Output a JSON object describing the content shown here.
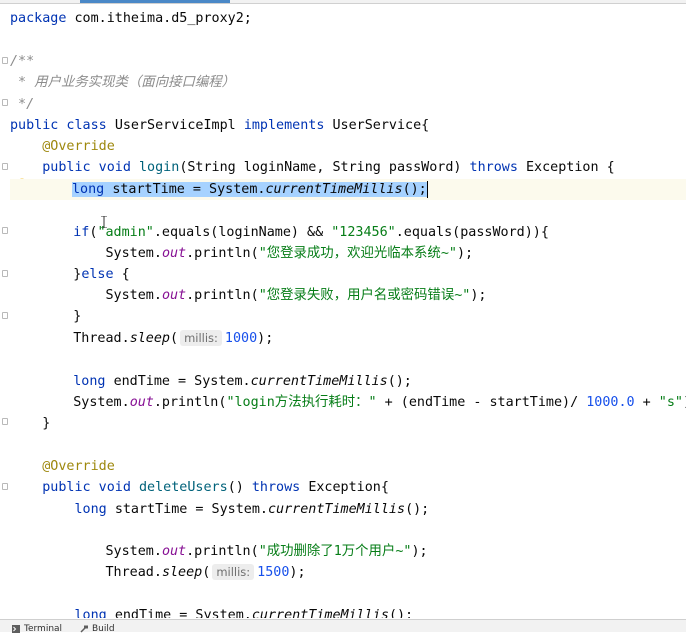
{
  "editor": {
    "lines": [
      {
        "id": "l1",
        "segments": [
          {
            "t": "package ",
            "c": "kw"
          },
          {
            "t": "com.itheima.d5_proxy2;"
          }
        ]
      },
      {
        "id": "l2",
        "segments": [
          {
            "t": "/**",
            "c": "cmt"
          }
        ]
      },
      {
        "id": "l3",
        "segments": [
          {
            "t": " * 用户业务实现类（面向接口编程）",
            "c": "cmt"
          }
        ]
      },
      {
        "id": "l4",
        "segments": [
          {
            "t": " */",
            "c": "cmt"
          }
        ]
      },
      {
        "id": "l5",
        "segments": [
          {
            "t": "public class ",
            "c": "kw"
          },
          {
            "t": "UserServiceImpl "
          },
          {
            "t": "implements ",
            "c": "kw"
          },
          {
            "t": "UserService{"
          }
        ]
      },
      {
        "id": "l6",
        "segments": [
          {
            "t": "    "
          },
          {
            "t": "@Override",
            "c": "ann"
          }
        ]
      },
      {
        "id": "l7",
        "segments": [
          {
            "t": "    "
          },
          {
            "t": "public void ",
            "c": "kw"
          },
          {
            "t": "login",
            "c": "meth"
          },
          {
            "t": "(String loginName, String passWord) "
          },
          {
            "t": "throws ",
            "c": "kw"
          },
          {
            "t": "Exception {"
          }
        ]
      },
      {
        "id": "l8",
        "segments": [
          {
            "t": "long ",
            "c": "kw sel"
          },
          {
            "t": "startTime = System.",
            "c": "sel"
          },
          {
            "t": "currentTimeMillis",
            "c": "ital sel"
          },
          {
            "t": "();",
            "c": "sel"
          }
        ]
      },
      {
        "id": "l9",
        "segments": [
          {
            "t": "    "
          },
          {
            "t": "if",
            "c": "kw"
          },
          {
            "t": "("
          },
          {
            "t": "\"admin\"",
            "c": "str"
          },
          {
            "t": ".equals(loginName) && "
          },
          {
            "t": "\"123456\"",
            "c": "str"
          },
          {
            "t": ".equals(passWord)){"
          }
        ]
      },
      {
        "id": "l10",
        "segments": [
          {
            "t": "        System."
          },
          {
            "t": "out",
            "c": "field"
          },
          {
            "t": ".println("
          },
          {
            "t": "\"您登录成功，欢迎光临本系统~\"",
            "c": "str"
          },
          {
            "t": ");"
          }
        ]
      },
      {
        "id": "l11",
        "segments": [
          {
            "t": "    }"
          },
          {
            "t": "else ",
            "c": "kw"
          },
          {
            "t": "{"
          }
        ]
      },
      {
        "id": "l12",
        "segments": [
          {
            "t": "        System."
          },
          {
            "t": "out",
            "c": "field"
          },
          {
            "t": ".println("
          },
          {
            "t": "\"您登录失败，用户名或密码错误~\"",
            "c": "str"
          },
          {
            "t": ");"
          }
        ]
      },
      {
        "id": "l13",
        "segments": [
          {
            "t": "    }"
          }
        ]
      },
      {
        "id": "l14",
        "segments": [
          {
            "t": "    Thread."
          },
          {
            "t": "sleep",
            "c": "ital"
          },
          {
            "t": "("
          },
          {
            "t": "millis:",
            "c": "hint"
          },
          {
            "t": "1000",
            "c": "num"
          },
          {
            "t": ");"
          }
        ]
      },
      {
        "id": "l15",
        "segments": [
          {
            "t": "    "
          },
          {
            "t": "long ",
            "c": "kw"
          },
          {
            "t": "endTime = System."
          },
          {
            "t": "currentTimeMillis",
            "c": "ital"
          },
          {
            "t": "();"
          }
        ]
      },
      {
        "id": "l16",
        "segments": [
          {
            "t": "    System."
          },
          {
            "t": "out",
            "c": "field"
          },
          {
            "t": ".println("
          },
          {
            "t": "\"login方法执行耗时：\"",
            "c": "str"
          },
          {
            "t": " + (endTime - startTime)/ "
          },
          {
            "t": "1000.0",
            "c": "num"
          },
          {
            "t": " + "
          },
          {
            "t": "\"s\"",
            "c": "str"
          },
          {
            "t": ");"
          }
        ]
      },
      {
        "id": "l17",
        "segments": [
          {
            "t": "    }"
          }
        ]
      },
      {
        "id": "l18",
        "segments": [
          {
            "t": "    "
          },
          {
            "t": "@Override",
            "c": "ann"
          }
        ]
      },
      {
        "id": "l19",
        "segments": [
          {
            "t": "    "
          },
          {
            "t": "public void ",
            "c": "kw"
          },
          {
            "t": "deleteUsers",
            "c": "meth"
          },
          {
            "t": "() "
          },
          {
            "t": "throws ",
            "c": "kw"
          },
          {
            "t": "Exception{"
          }
        ]
      },
      {
        "id": "l20",
        "segments": [
          {
            "t": "        "
          },
          {
            "t": "long ",
            "c": "kw"
          },
          {
            "t": "startTime = System."
          },
          {
            "t": "currentTimeMillis",
            "c": "ital"
          },
          {
            "t": "();"
          }
        ]
      },
      {
        "id": "l21",
        "segments": [
          {
            "t": "        System."
          },
          {
            "t": "out",
            "c": "field"
          },
          {
            "t": ".println("
          },
          {
            "t": "\"成功删除了1万个用户~\"",
            "c": "str"
          },
          {
            "t": ");"
          }
        ]
      },
      {
        "id": "l22",
        "segments": [
          {
            "t": "        Thread."
          },
          {
            "t": "sleep",
            "c": "ital"
          },
          {
            "t": "("
          },
          {
            "t": "millis:",
            "c": "hint"
          },
          {
            "t": "1500",
            "c": "num"
          },
          {
            "t": ");"
          }
        ]
      },
      {
        "id": "l23",
        "segments": [
          {
            "t": "        "
          },
          {
            "t": "long ",
            "c": "kw"
          },
          {
            "t": "endTime = System."
          },
          {
            "t": "currentTimeMillis",
            "c": "ital"
          },
          {
            "t": "();"
          }
        ]
      }
    ]
  },
  "statusbar": {
    "terminal_label": "Terminal",
    "build_label": "Build"
  },
  "icons": {
    "intention_bulb": "lightbulb-icon",
    "terminal": "terminal-icon",
    "build": "hammer-icon"
  }
}
